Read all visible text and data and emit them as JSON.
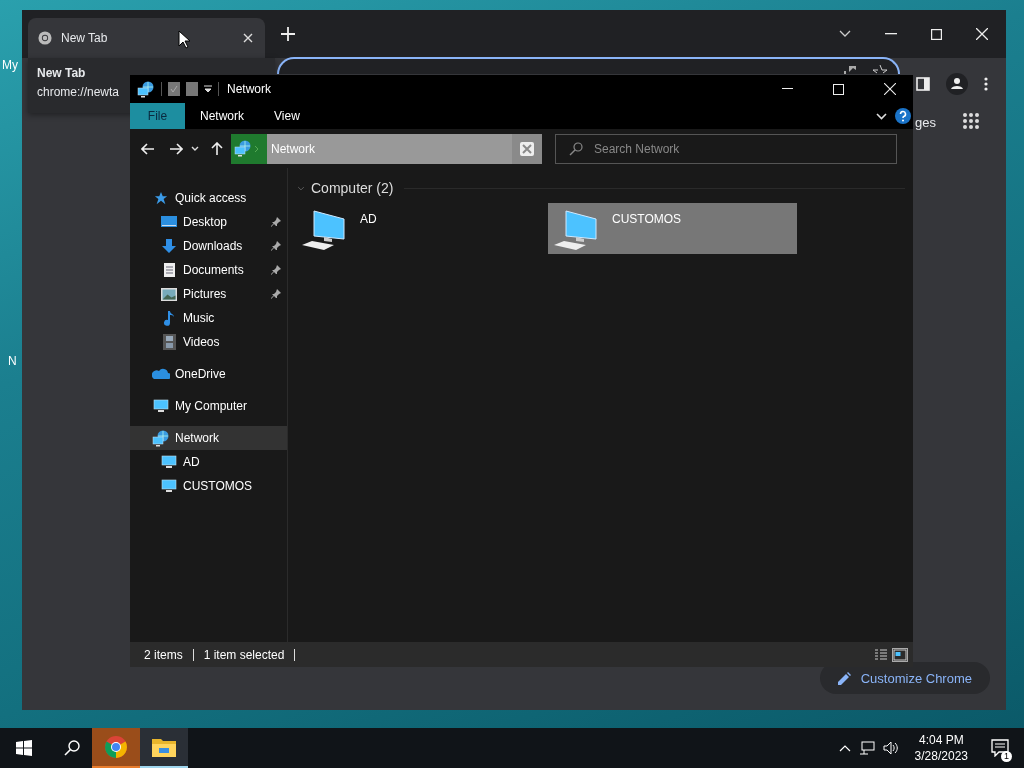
{
  "desktop": {
    "icon_labels": [
      "My",
      "N"
    ]
  },
  "browser": {
    "tab": {
      "title": "New Tab",
      "selected": true
    },
    "hover_card": {
      "title": "New Tab",
      "url": "chrome://newta"
    },
    "page": {
      "partial_link": "ges",
      "customize_button": "Customize Chrome"
    }
  },
  "explorer": {
    "title": "Network",
    "ribbon_tabs": [
      {
        "label": "File",
        "selected": true
      },
      {
        "label": "Network",
        "selected": false
      },
      {
        "label": "View",
        "selected": false
      }
    ],
    "address": "Network",
    "search": {
      "placeholder": "Search Network"
    },
    "sidebar": [
      {
        "label": "Quick access",
        "kind": "star",
        "selected": false,
        "children": [
          {
            "label": "Desktop",
            "kind": "desktop",
            "pinned": true,
            "selected": false
          },
          {
            "label": "Downloads",
            "kind": "download",
            "pinned": true,
            "selected": false
          },
          {
            "label": "Documents",
            "kind": "document",
            "pinned": true,
            "selected": false
          },
          {
            "label": "Pictures",
            "kind": "picture",
            "pinned": true,
            "selected": false
          },
          {
            "label": "Music",
            "kind": "music",
            "pinned": false,
            "selected": false
          },
          {
            "label": "Videos",
            "kind": "video",
            "pinned": false,
            "selected": false
          }
        ]
      },
      {
        "label": "OneDrive",
        "kind": "cloud",
        "selected": false
      },
      {
        "label": "My Computer",
        "kind": "computer",
        "selected": false
      },
      {
        "label": "Network",
        "kind": "network",
        "selected": true,
        "children": [
          {
            "label": "AD",
            "kind": "computer",
            "pinned": false,
            "selected": false
          },
          {
            "label": "CUSTOMOS",
            "kind": "computer",
            "pinned": false,
            "selected": false
          }
        ]
      }
    ],
    "group": {
      "title": "Computer (2)",
      "expanded": true
    },
    "items": [
      {
        "name": "AD",
        "selected": false
      },
      {
        "name": "CUSTOMOS",
        "selected": true
      }
    ],
    "status": [
      "2 items",
      "1 item selected"
    ],
    "view_modes": [
      {
        "kind": "details",
        "selected": false
      },
      {
        "kind": "tiles",
        "selected": true
      }
    ]
  },
  "taskbar": {
    "apps": [
      {
        "kind": "chrome",
        "attention": true
      },
      {
        "kind": "explorer",
        "attention": false
      }
    ],
    "time": "4:04 PM",
    "date": "3/28/2023",
    "notification_count": "1"
  }
}
